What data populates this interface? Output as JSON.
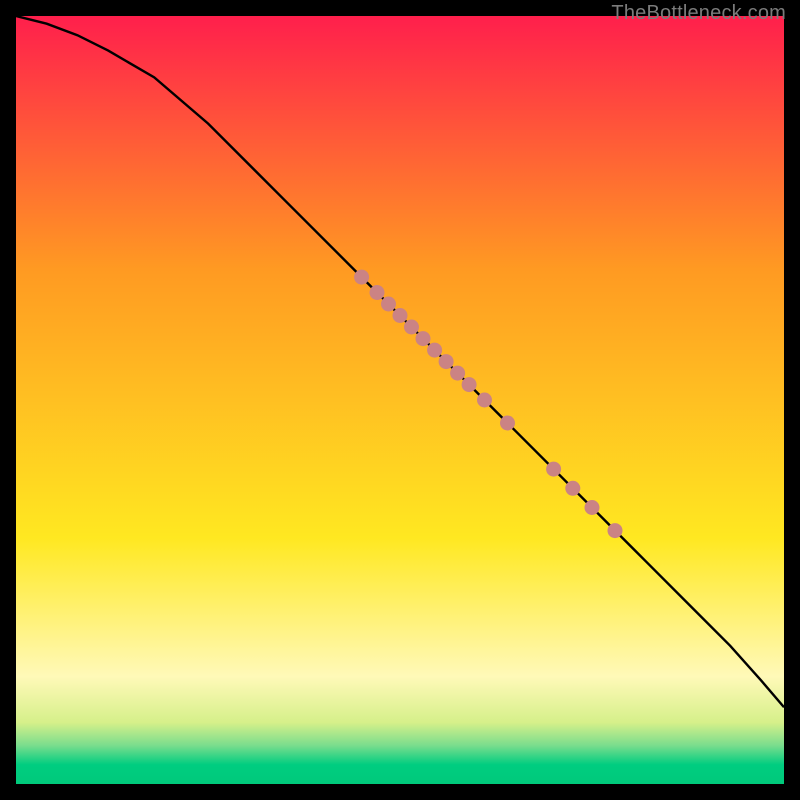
{
  "watermark": "TheBottleneck.com",
  "chart_data": {
    "type": "line",
    "title": "",
    "xlabel": "",
    "ylabel": "",
    "xlim": [
      0,
      100
    ],
    "ylim": [
      0,
      100
    ],
    "series": [
      {
        "name": "curve",
        "x": [
          0,
          4,
          8,
          12,
          18,
          25,
          35,
          45,
          55,
          65,
          75,
          82,
          88,
          93,
          97,
          100
        ],
        "y": [
          100,
          99,
          97.5,
          95.5,
          92,
          86,
          76,
          66,
          56,
          46,
          36,
          29,
          23,
          18,
          13.5,
          10
        ]
      },
      {
        "name": "points",
        "x": [
          45,
          47,
          48.5,
          50,
          51.5,
          53,
          54.5,
          56,
          57.5,
          59,
          61,
          64,
          70,
          72.5,
          75,
          78
        ],
        "y": [
          66,
          64,
          62.5,
          61,
          59.5,
          58,
          56.5,
          55,
          53.5,
          52,
          50,
          47,
          41,
          38.5,
          36,
          33
        ]
      }
    ],
    "background_gradient": {
      "top_rgb": "#ff1f4c",
      "orange_rgb": "#ff9a22",
      "yellow_rgb": "#ffe821",
      "pale_rgb": "#fff9b8",
      "green_rgb": "#00c97b"
    },
    "point_color": "#cb8384",
    "curve_color": "#000000"
  }
}
